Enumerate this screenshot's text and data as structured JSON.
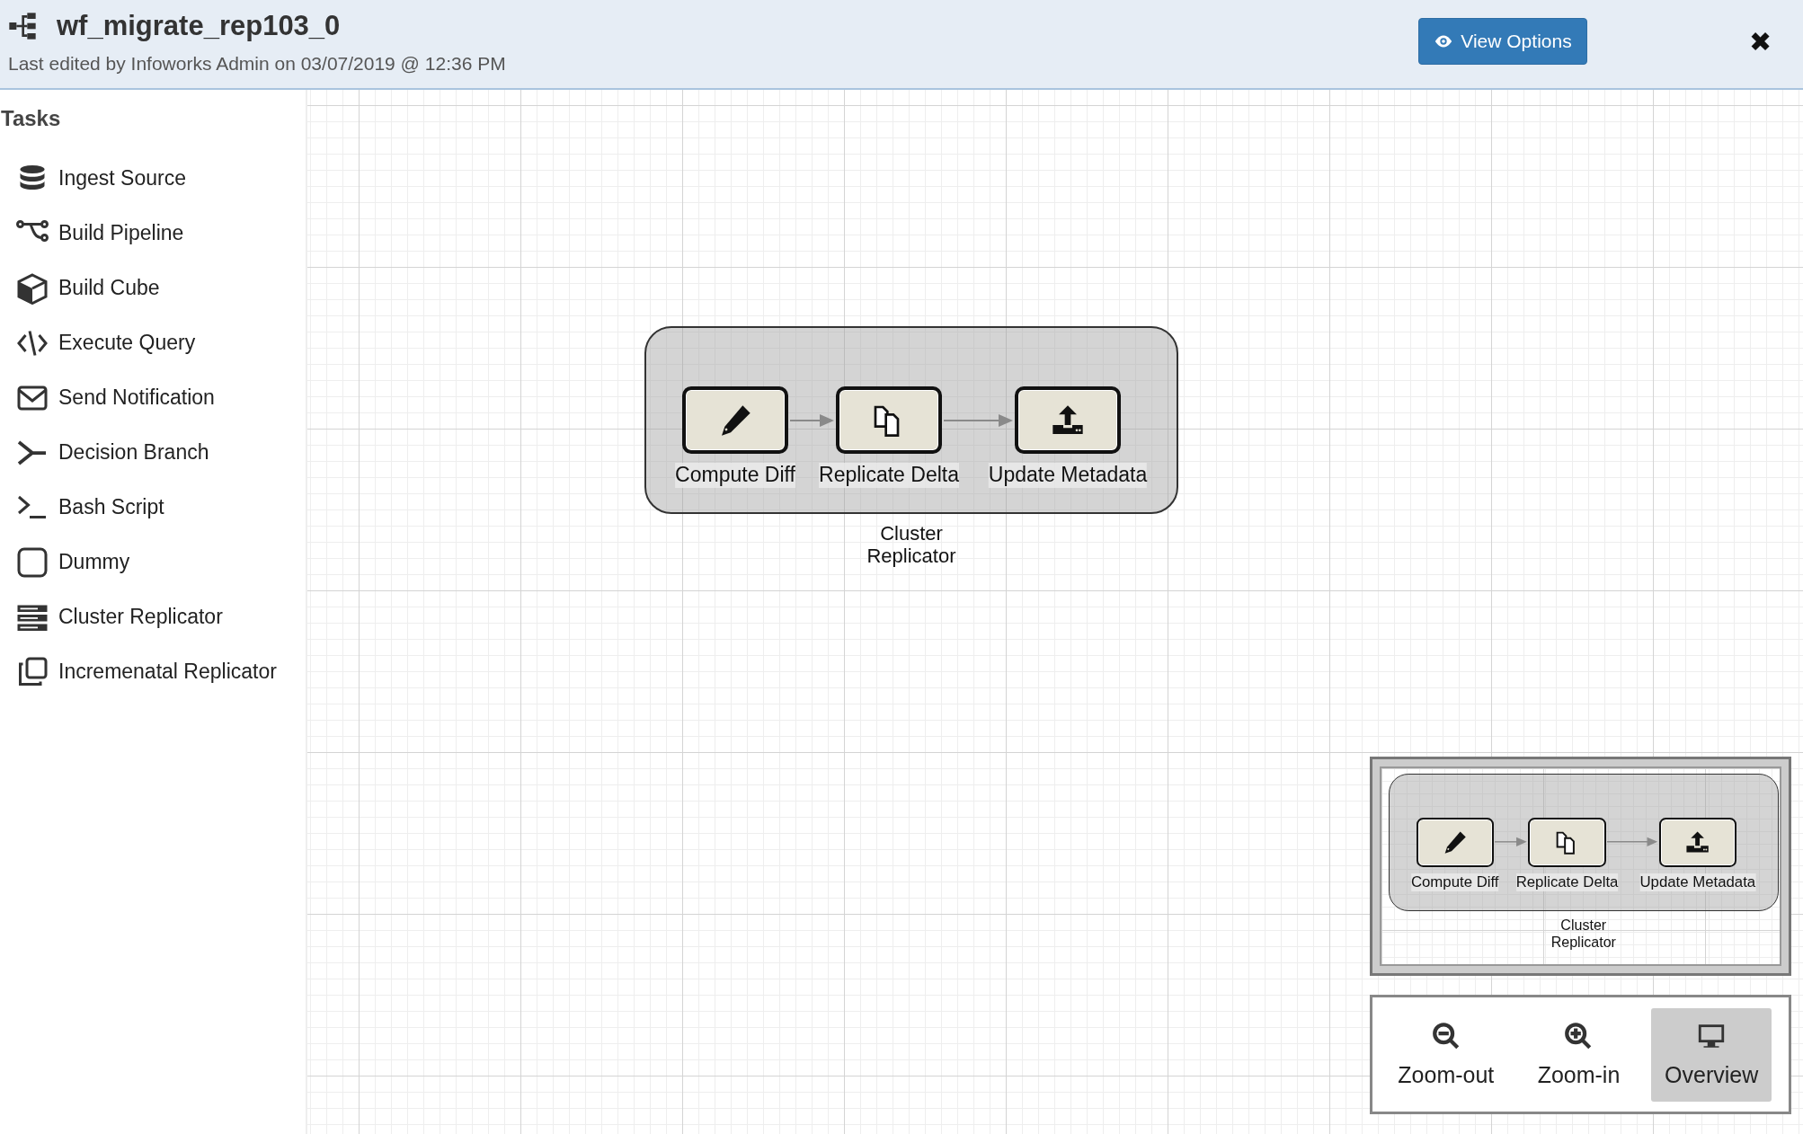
{
  "header": {
    "title": "wf_migrate_rep103_0",
    "subtitle": "Last edited by Infoworks Admin on 03/07/2019 @ 12:36 PM",
    "view_options_button": "View Options",
    "close_button": "✖"
  },
  "sidebar": {
    "title": "Tasks",
    "items": [
      {
        "label": "Ingest Source",
        "kind": "database"
      },
      {
        "label": "Build Pipeline",
        "kind": "pipeline"
      },
      {
        "label": "Build Cube",
        "kind": "cube"
      },
      {
        "label": "Execute Query",
        "kind": "code"
      },
      {
        "label": "Send Notification",
        "kind": "envelope"
      },
      {
        "label": "Decision Branch",
        "kind": "branch"
      },
      {
        "label": "Bash Script",
        "kind": "terminal"
      },
      {
        "label": "Dummy",
        "kind": "square"
      },
      {
        "label": "Cluster Replicator",
        "kind": "servers"
      },
      {
        "label": "Incremenatal Replicator",
        "kind": "copy"
      }
    ]
  },
  "canvas": {
    "group": {
      "label": "Cluster Replicator",
      "nodes": [
        {
          "label": "Compute Diff",
          "kind": "pencil"
        },
        {
          "label": "Replicate Delta",
          "kind": "copy"
        },
        {
          "label": "Update Metadata",
          "kind": "upload"
        }
      ]
    }
  },
  "minimap": {
    "group": {
      "label": "Cluster Replicator",
      "nodes": [
        {
          "label": "Compute Diff",
          "kind": "pencil"
        },
        {
          "label": "Replicate Delta",
          "kind": "copy"
        },
        {
          "label": "Update Metadata",
          "kind": "upload"
        }
      ]
    }
  },
  "zoom_controls": [
    {
      "label": "Zoom-out",
      "kind": "zoom-out",
      "selected": false
    },
    {
      "label": "Zoom-in",
      "kind": "zoom-in",
      "selected": false
    },
    {
      "label": "Overview",
      "kind": "monitor",
      "selected": true
    }
  ]
}
